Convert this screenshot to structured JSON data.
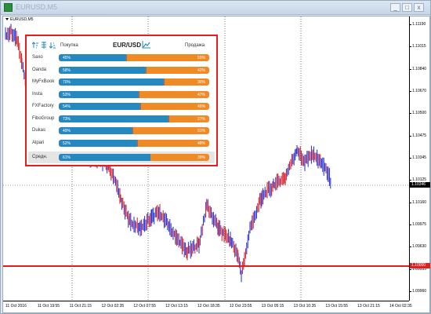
{
  "window": {
    "title": "EURUSD,M5",
    "min_label": "_",
    "max_label": "□",
    "close_label": "x"
  },
  "chart": {
    "symbol_label": "EURUSD,M5",
    "y_ticks": [
      "1.11190",
      "1.11015",
      "1.10840",
      "1.10670",
      "1.10500",
      "1.10475",
      "1.10345",
      "1.10125",
      "1.10160",
      "1.09975",
      "1.09630",
      "1.09955",
      "1.09960"
    ],
    "current_price": "1.10346",
    "level_price": "1.10000",
    "x_ticks": [
      "11 Oct 2016",
      "11 Oct 19:55",
      "11 Oct 21:15",
      "12 Oct 02:35",
      "12 Oct 07:55",
      "12 Oct 13:15",
      "12 Oct 18:35",
      "12 Oct 23:55",
      "13 Oct 05:15",
      "13 Oct 10:35",
      "13 Oct 15:55",
      "13 Oct 21:15",
      "14 Oct 02:35"
    ]
  },
  "widget": {
    "buy_header": "Покупка",
    "pair": "EUR/USD",
    "sell_header": "Продажа",
    "rows": [
      {
        "broker": "Saxo",
        "buy": "45%",
        "sell": "55%",
        "buy_value": 45
      },
      {
        "broker": "Oanda",
        "buy": "58%",
        "sell": "42%",
        "buy_value": 58
      },
      {
        "broker": "MyFxBook",
        "buy": "70%",
        "sell": "30%",
        "buy_value": 70
      },
      {
        "broker": "Insta",
        "buy": "53%",
        "sell": "47%",
        "buy_value": 53
      },
      {
        "broker": "FXFactory",
        "buy": "54%",
        "sell": "46%",
        "buy_value": 54
      },
      {
        "broker": "FiboGroup",
        "buy": "73%",
        "sell": "27%",
        "buy_value": 73
      },
      {
        "broker": "Dukas",
        "buy": "49%",
        "sell": "51%",
        "buy_value": 49
      },
      {
        "broker": "Alpari",
        "buy": "52%",
        "sell": "48%",
        "buy_value": 52
      }
    ],
    "average": {
      "broker": "Средн.",
      "buy": "61%",
      "sell": "39%",
      "buy_value": 61
    }
  },
  "colors": {
    "buy_bar": "#2389c0",
    "sell_bar": "#f08a24",
    "highlight_border": "#e21e1e",
    "bull_candle": "#1a2ad6",
    "bear_candle": "#d6151d"
  }
}
